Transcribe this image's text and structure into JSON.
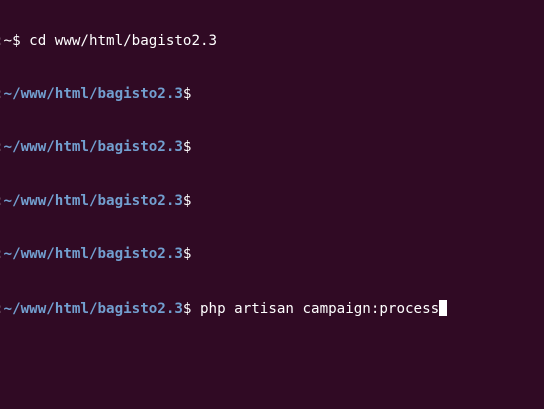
{
  "terminal": {
    "colors": {
      "background": "#300a24",
      "text": "#ffffff",
      "path": "#729fcf",
      "cursor": "#ffffff"
    },
    "lines": [
      {
        "prefix": ":",
        "path": "~",
        "sigil": "$",
        "command": " cd www/html/bagisto2.3",
        "path_bold": false
      },
      {
        "prefix": ":",
        "path": "~/www/html/bagisto2.3",
        "sigil": "$",
        "command": ""
      },
      {
        "prefix": ":",
        "path": "~/www/html/bagisto2.3",
        "sigil": "$",
        "command": ""
      },
      {
        "prefix": ":",
        "path": "~/www/html/bagisto2.3",
        "sigil": "$",
        "command": ""
      },
      {
        "prefix": ":",
        "path": "~/www/html/bagisto2.3",
        "sigil": "$",
        "command": ""
      },
      {
        "prefix": ":",
        "path": "~/www/html/bagisto2.3",
        "sigil": "$",
        "command": " php artisan campaign:process"
      }
    ]
  }
}
